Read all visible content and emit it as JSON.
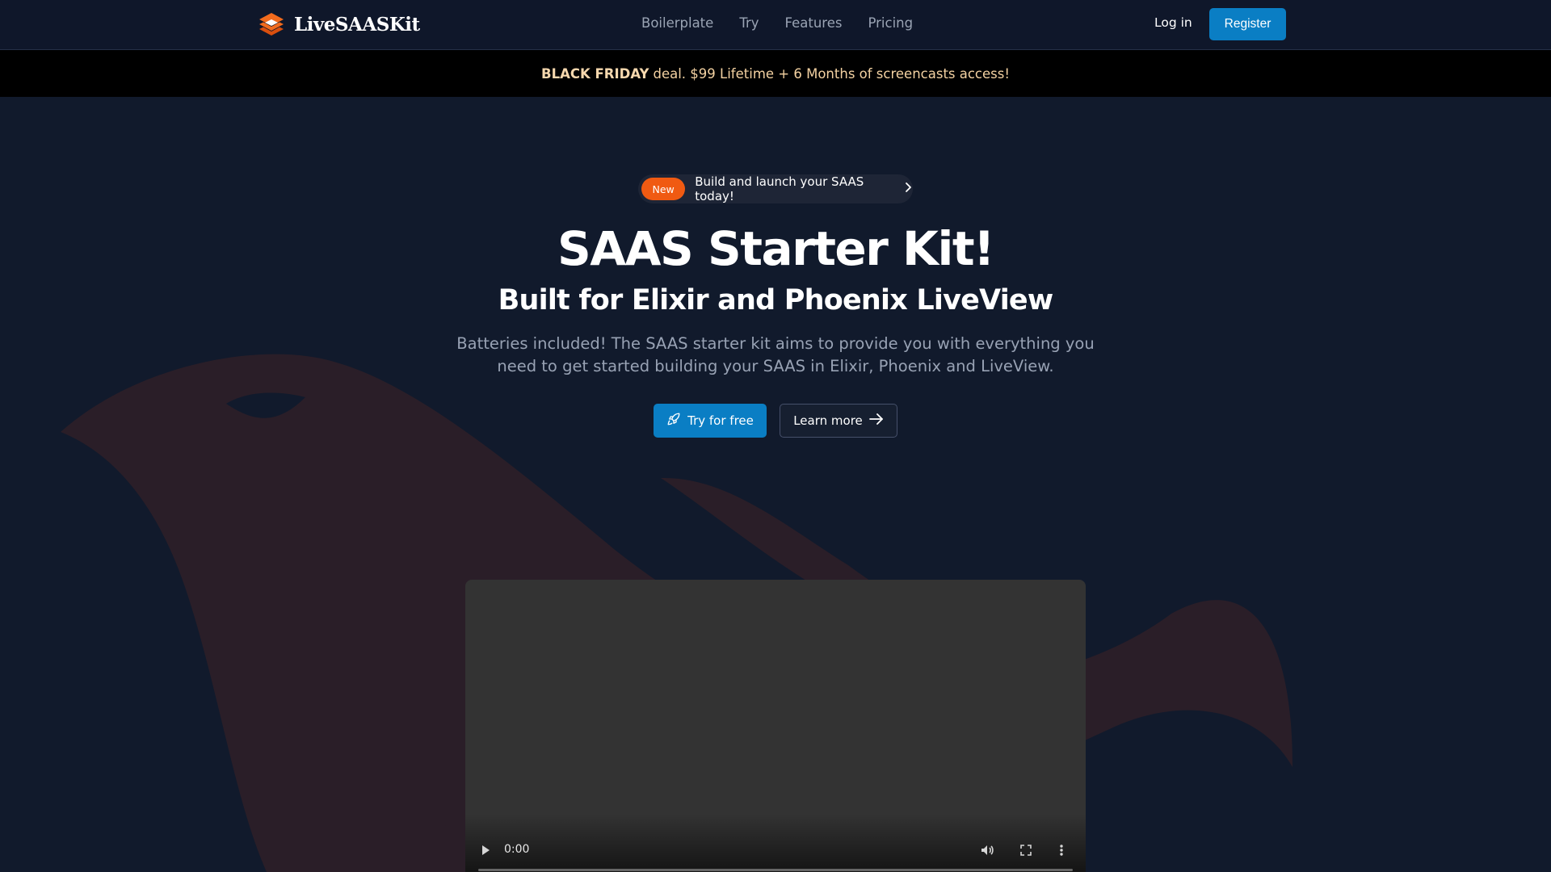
{
  "brand": {
    "name": "LiveSAASKit",
    "logo_icon": "stacked-layers-logo-icon",
    "logo_color": "#f26b1d"
  },
  "nav": {
    "items": [
      {
        "label": "Boilerplate"
      },
      {
        "label": "Try"
      },
      {
        "label": "Features"
      },
      {
        "label": "Pricing"
      }
    ],
    "login_label": "Log in",
    "register_label": "Register"
  },
  "promo": {
    "highlight": "BLACK FRIDAY",
    "text": "deal. $99 Lifetime + 6 Months of screencasts access!"
  },
  "hero": {
    "badge_label": "New",
    "badge_text": "Build and launch your SAAS today!",
    "title": "SAAS Starter Kit!",
    "subtitle": "Built for Elixir and Phoenix LiveView",
    "description": "Batteries included! The SAAS starter kit aims to provide you with everything you need to get started building your SAAS in Elixir, Phoenix and LiveView.",
    "primary_cta": "Try for free",
    "secondary_cta": "Learn more",
    "background_art": "phoenix-bird-illustration"
  },
  "video": {
    "time": "0:00",
    "icons": [
      "play-icon",
      "volume-icon",
      "fullscreen-icon",
      "more-options-icon"
    ]
  },
  "colors": {
    "page_bg": "#111a2c",
    "header_bg": "#0f172a",
    "accent_blue": "#0a7ec4",
    "accent_orange": "#f05a12",
    "promo_text": "#f4d2a2",
    "bird": "#2a1e28"
  }
}
